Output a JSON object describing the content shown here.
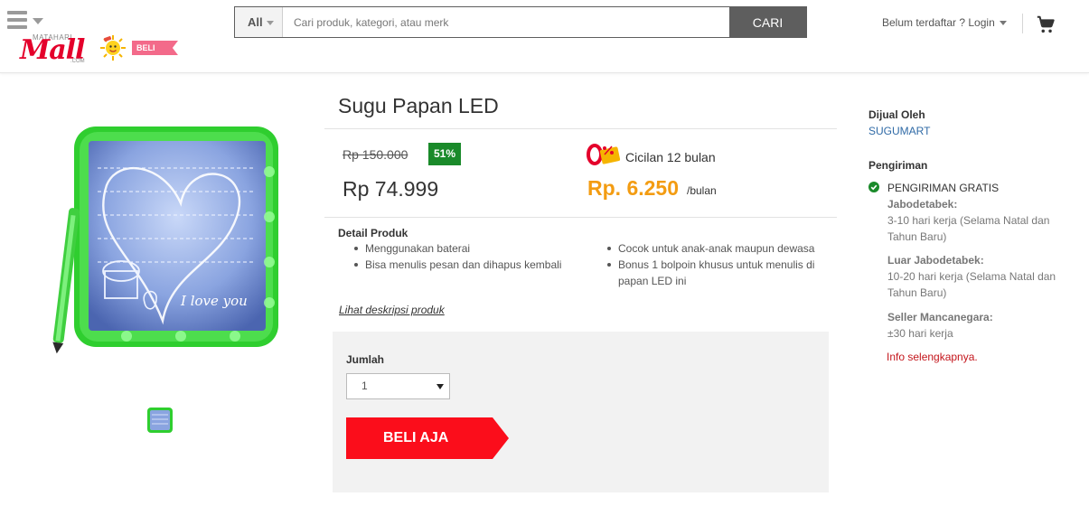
{
  "header": {
    "menu_icon": "hamburger-icon",
    "logo": {
      "small_text": "MATAHARI",
      "main_text": "Mall",
      "domain_text": ".COM",
      "badge": "BELI AJA"
    },
    "search": {
      "category": "All",
      "placeholder": "Cari produk, kategori, atau merk",
      "value": "",
      "button_label": "CARI"
    },
    "login_label": "Belum terdaftar ? Login",
    "cart_icon": "cart-icon"
  },
  "product": {
    "title": "Sugu Papan LED",
    "old_price": "Rp 150.000",
    "discount": "51%",
    "price": "Rp 74.999",
    "installment": {
      "label": "Cicilan 12 bulan",
      "amount": "Rp. 6.250",
      "unit": "/bulan",
      "icon": "zero-percent-icon"
    },
    "detail_heading": "Detail Produk",
    "features_left": [
      "Menggunakan baterai",
      "Bisa menulis pesan dan dihapus kembali"
    ],
    "features_right": [
      "Cocok untuk anak-anak maupun dewasa",
      "Bonus 1 bolpoin khusus untuk menulis di papan LED ini"
    ],
    "description_link": "Lihat deskripsi produk",
    "image_text": "I love you"
  },
  "purchase": {
    "quantity_label": "Jumlah",
    "quantity_value": "1",
    "buy_label": "BELI AJA"
  },
  "seller": {
    "heading": "Dijual Oleh",
    "name": "SUGUMART"
  },
  "shipping": {
    "heading": "Pengiriman",
    "free_label": "PENGIRIMAN GRATIS",
    "zones": [
      {
        "title": "Jabodetabek:",
        "value": "3-10 hari kerja (Selama Natal dan Tahun Baru)"
      },
      {
        "title": "Luar Jabodetabek:",
        "value": "10-20 hari kerja (Selama Natal dan Tahun Baru)"
      },
      {
        "title": "Seller Mancanegara:",
        "value": "±30 hari kerja"
      }
    ],
    "info_link": "Info selengkapnya."
  },
  "colors": {
    "accent_red": "#fb0d1b",
    "discount_green": "#1a8a2a",
    "installment_orange": "#f39c12",
    "link_blue": "#2f6aa6"
  }
}
